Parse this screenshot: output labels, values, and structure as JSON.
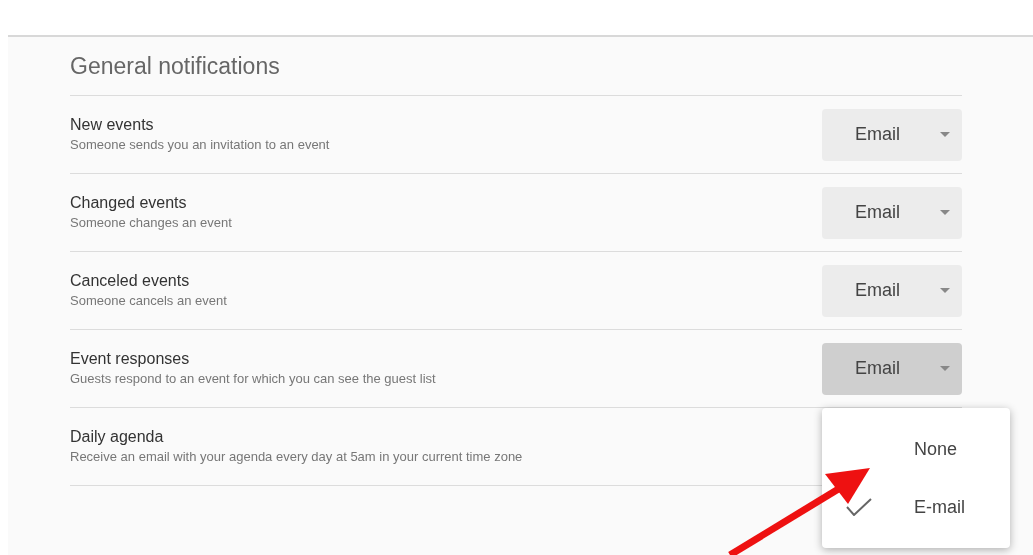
{
  "section": {
    "title": "General notifications"
  },
  "rows": [
    {
      "title": "New events",
      "description": "Someone sends you an invitation to an event",
      "value": "Email",
      "open": false
    },
    {
      "title": "Changed events",
      "description": "Someone changes an event",
      "value": "Email",
      "open": false
    },
    {
      "title": "Canceled events",
      "description": "Someone cancels an event",
      "value": "Email",
      "open": false
    },
    {
      "title": "Event responses",
      "description": "Guests respond to an event for which you can see the guest list",
      "value": "Email",
      "open": true
    },
    {
      "title": "Daily agenda",
      "description": "Receive an email with your agenda every day at 5am in your current time zone"
    }
  ],
  "menu": {
    "options": [
      {
        "label": "None",
        "selected": false
      },
      {
        "label": "E-mail",
        "selected": true
      }
    ]
  }
}
